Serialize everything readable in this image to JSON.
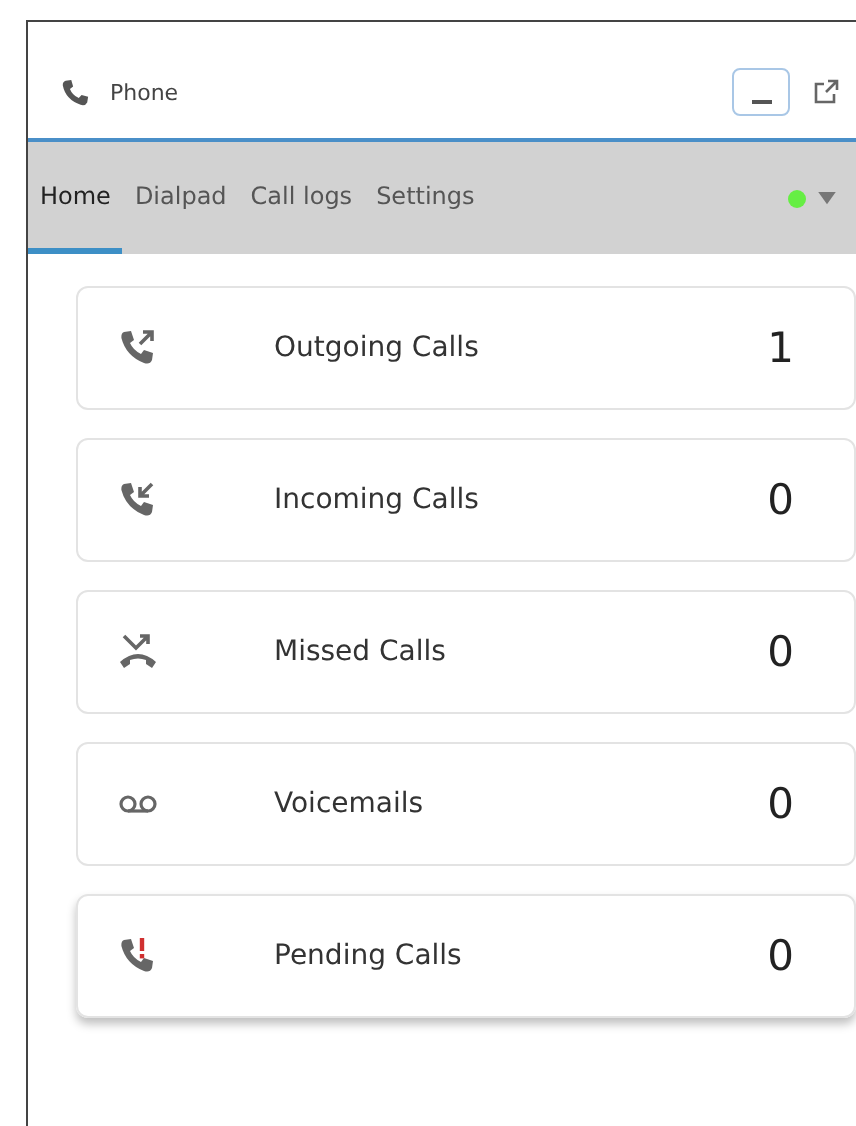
{
  "window": {
    "title": "Phone"
  },
  "tabs": [
    {
      "label": "Home",
      "selected": true
    },
    {
      "label": "Dialpad",
      "selected": false
    },
    {
      "label": "Call logs",
      "selected": false
    },
    {
      "label": "Settings",
      "selected": false
    }
  ],
  "status": {
    "color": "#66ee44"
  },
  "cards": [
    {
      "kind": "outgoing",
      "label": "Outgoing Calls",
      "count": "1",
      "selected": false
    },
    {
      "kind": "incoming",
      "label": "Incoming Calls",
      "count": "0",
      "selected": false
    },
    {
      "kind": "missed",
      "label": "Missed Calls",
      "count": "0",
      "selected": false
    },
    {
      "kind": "voicemail",
      "label": "Voicemails",
      "count": "0",
      "selected": false
    },
    {
      "kind": "pending",
      "label": "Pending Calls",
      "count": "0",
      "selected": true
    }
  ]
}
